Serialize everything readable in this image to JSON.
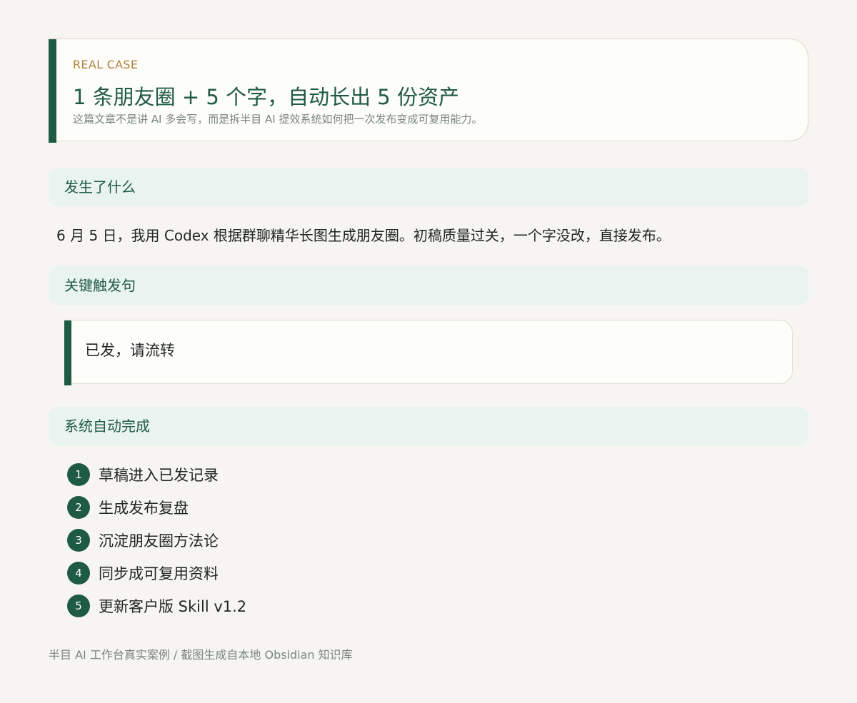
{
  "header": {
    "eyebrow": "REAL CASE",
    "title": "1 条朋友圈 + 5 个字，自动长出 5 份资产",
    "subtitle": "这篇文章不是讲 AI 多会写，而是拆半目 AI 提效系统如何把一次发布变成可复用能力。"
  },
  "section_what": {
    "heading": "发生了什么",
    "text": "6 月 5 日，我用 Codex 根据群聊精华长图生成朋友圈。初稿质量过关，一个字没改，直接发布。"
  },
  "section_trigger": {
    "heading": "关键触发句",
    "quote": "已发，请流转"
  },
  "section_auto": {
    "heading": "系统自动完成",
    "steps": [
      {
        "num": "1",
        "label": "草稿进入已发记录"
      },
      {
        "num": "2",
        "label": "生成发布复盘"
      },
      {
        "num": "3",
        "label": "沉淀朋友圈方法论"
      },
      {
        "num": "4",
        "label": "同步成可复用资料"
      },
      {
        "num": "5",
        "label": "更新客户版 Skill v1.2"
      }
    ]
  },
  "footer": {
    "text": "半目 AI 工作台真实案例 / 截图生成自本地 Obsidian 知识库"
  },
  "colors": {
    "accent": "#1f5a45",
    "eyebrow": "#b0823e",
    "section_bg": "#e9f3ef",
    "page_bg": "#f6f5f1"
  }
}
